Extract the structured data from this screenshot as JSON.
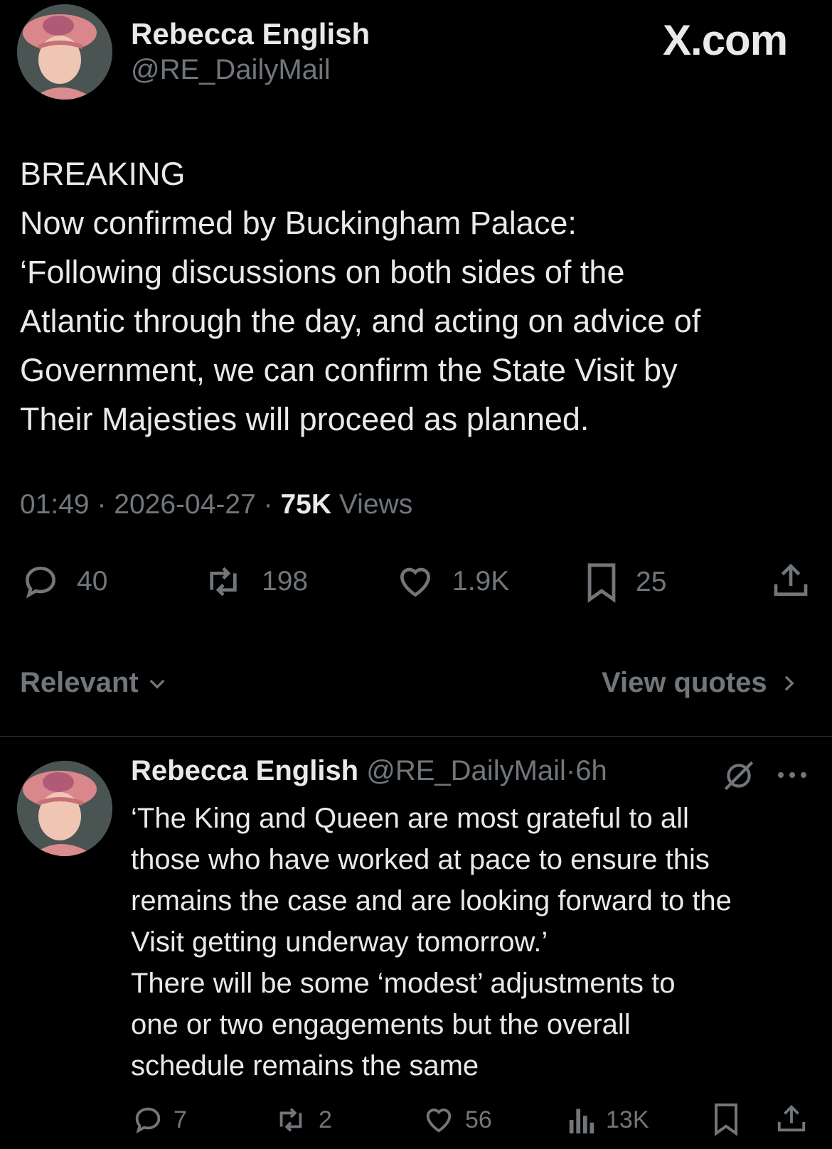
{
  "tweet": {
    "author_name": "Rebecca English",
    "author_handle": "@RE_DailyMail",
    "brand_label": "X.com",
    "body_lines": [
      "BREAKING",
      "Now confirmed by Buckingham Palace:",
      "‘Following discussions on both sides of the",
      "Atlantic through the day, and acting on advice of",
      "Government, we can confirm the State Visit by",
      "Their Majesties will proceed as planned."
    ],
    "time": "01:49",
    "date": "2026-04-27",
    "views_count": "75K",
    "views_label": "Views",
    "separator": "·",
    "actions": {
      "replies": "40",
      "reposts": "198",
      "likes": "1.9K",
      "bookmarks": "25"
    }
  },
  "sort_bar": {
    "sort_label": "Relevant",
    "quotes_label": "View quotes"
  },
  "reply": {
    "author_name": "Rebecca English",
    "author_handle": "@RE_DailyMail",
    "age": "6h",
    "separator": "·",
    "body_lines": [
      "‘The King and Queen are most grateful to all",
      "those who have worked at pace to ensure this",
      "remains the case and are looking forward to the",
      "Visit getting underway tomorrow.’",
      "There will be some ‘modest’ adjustments to",
      "one or two engagements but the overall",
      "schedule remains the same"
    ],
    "actions": {
      "replies": "7",
      "reposts": "2",
      "likes": "56",
      "views": "13K"
    }
  },
  "colors": {
    "background": "#000000",
    "text_primary": "#e7e9ea",
    "text_secondary": "#71767b",
    "divider": "#2f3336"
  },
  "icons": [
    "reply-icon",
    "repost-icon",
    "like-icon",
    "bookmark-icon",
    "share-icon",
    "chevron-down-icon",
    "chevron-right-icon",
    "grok-icon",
    "more-icon",
    "views-icon"
  ]
}
